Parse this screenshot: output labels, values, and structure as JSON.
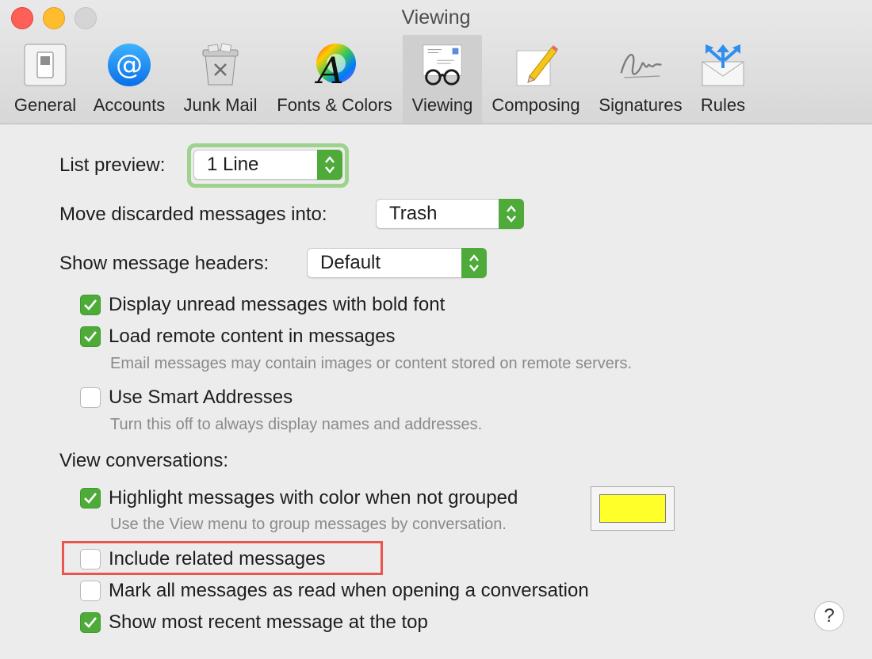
{
  "window": {
    "title": "Viewing"
  },
  "toolbar": [
    {
      "label": "General",
      "icon": "general-switch-icon"
    },
    {
      "label": "Accounts",
      "icon": "at-sign-icon"
    },
    {
      "label": "Junk Mail",
      "icon": "junk-bin-icon"
    },
    {
      "label": "Fonts & Colors",
      "icon": "fonts-colors-icon"
    },
    {
      "label": "Viewing",
      "icon": "glasses-icon",
      "selected": true
    },
    {
      "label": "Composing",
      "icon": "pencil-paper-icon"
    },
    {
      "label": "Signatures",
      "icon": "signature-icon"
    },
    {
      "label": "Rules",
      "icon": "rules-envelope-icon"
    }
  ],
  "settings": {
    "list_preview": {
      "label": "List preview:",
      "value": "1 Line"
    },
    "move_discarded": {
      "label": "Move discarded messages into:",
      "value": "Trash"
    },
    "message_headers": {
      "label": "Show message headers:",
      "value": "Default"
    },
    "bold_unread": {
      "label": "Display unread messages with bold font",
      "checked": true
    },
    "remote_content": {
      "label": "Load remote content in messages",
      "checked": true,
      "hint": "Email messages may contain images or content stored on remote servers."
    },
    "smart_addresses": {
      "label": "Use Smart Addresses",
      "checked": false,
      "hint": "Turn this off to always display names and addresses."
    },
    "view_conversations_heading": "View conversations:",
    "highlight_color": {
      "label": "Highlight messages with color when not grouped",
      "checked": true,
      "hint": "Use the View menu to group messages by conversation.",
      "color": "#ffff2a"
    },
    "include_related": {
      "label": "Include related messages",
      "checked": false
    },
    "mark_all_read": {
      "label": "Mark all messages as read when opening a conversation",
      "checked": false
    },
    "most_recent_top": {
      "label": "Show most recent message at the top",
      "checked": true
    }
  },
  "help_button": "?",
  "colors": {
    "accent": "#4eab39",
    "highlight_outline": "#e8564f"
  }
}
